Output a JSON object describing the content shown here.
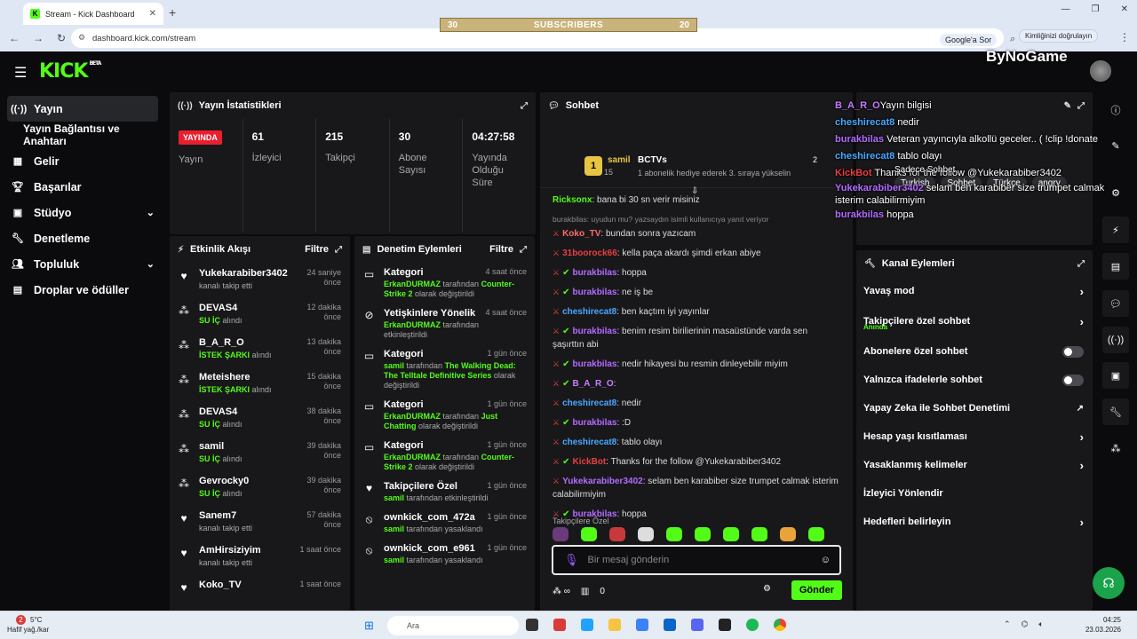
{
  "browser": {
    "tab_title": "Stream - Kick Dashboard",
    "url": "dashboard.kick.com/stream",
    "google_pill": "Google'a Sor",
    "verify_pill": "Kimliğinizi doğrulayın"
  },
  "sub_banner": {
    "left": "30",
    "title": "SUBSCRIBERS",
    "right": "20"
  },
  "header": {
    "logo": "KICK",
    "logo_beta": "BETA",
    "bynogame": "ByNoGame"
  },
  "sidebar": {
    "items": [
      {
        "label": "Yayın",
        "icon": "broadcast-icon"
      },
      {
        "label": "Yayın Bağlantısı ve Anahtarı"
      },
      {
        "label": "Gelir",
        "icon": "chart-icon"
      },
      {
        "label": "Başarılar",
        "icon": "trophy-icon"
      },
      {
        "label": "Stüdyo",
        "icon": "studio-icon"
      },
      {
        "label": "Denetleme",
        "icon": "wrench-icon"
      },
      {
        "label": "Topluluk",
        "icon": "people-icon"
      },
      {
        "label": "Droplar ve ödüller",
        "icon": "gift-icon"
      }
    ]
  },
  "stats": {
    "title": "Yayın İstatistikleri",
    "live": "YAYINDA",
    "live_label": "Yayın",
    "viewers": "61",
    "viewers_label": "İzleyici",
    "followers": "215",
    "followers_label": "Takipçi",
    "subs": "30",
    "subs_label": "Abone Sayısı",
    "duration": "04:27:58",
    "duration_label": "Yayında Olduğu Süre"
  },
  "activity": {
    "title": "Etkinlik Akışı",
    "filter": "Filtre",
    "items": [
      {
        "name": "Yukekarabiber3402",
        "desc": "kanalı takip etti",
        "hl": "",
        "time": "24 saniye önce"
      },
      {
        "name": "DEVAS4",
        "hl": "SU İÇ",
        "desc": " alındı",
        "time": "12 dakika önce"
      },
      {
        "name": "B_A_R_O",
        "hl": "İSTEK ŞARKI",
        "desc": " alındı",
        "time": "13 dakika önce"
      },
      {
        "name": "Meteishere",
        "hl": "İSTEK ŞARKI",
        "desc": " alındı",
        "time": "15 dakika önce"
      },
      {
        "name": "DEVAS4",
        "hl": "SU İÇ",
        "desc": " alındı",
        "time": "38 dakika önce"
      },
      {
        "name": "samil",
        "hl": "SU İÇ",
        "desc": " alındı",
        "time": "39 dakika önce"
      },
      {
        "name": "Gevrocky0",
        "hl": "SU İÇ",
        "desc": " alındı",
        "time": "39 dakika önce"
      },
      {
        "name": "Sanem7",
        "hl": "",
        "desc": "kanalı takip etti",
        "time": "57 dakika önce"
      },
      {
        "name": "AmHirsiziyim",
        "hl": "",
        "desc": "kanalı takip etti",
        "time": "1 saat önce"
      },
      {
        "name": "Koko_TV",
        "hl": "",
        "desc": "",
        "time": "1 saat önce"
      }
    ]
  },
  "moderation": {
    "title": "Denetim Eylemleri",
    "filter": "Filtre",
    "items": [
      {
        "name": "Kategori",
        "time": "4 saat önce",
        "u": "ErkanDURMAZ",
        "mid": " tarafından ",
        "hl": "Counter-Strike 2",
        "end": " olarak değiştirildi"
      },
      {
        "name": "Yetişkinlere Yönelik",
        "time": "4 saat önce",
        "u": "ErkanDURMAZ",
        "mid": " tarafından etkinleştirildi",
        "hl": "",
        "end": ""
      },
      {
        "name": "Kategori",
        "time": "1 gün önce",
        "u": "samil",
        "mid": " tarafından ",
        "hl": "The Walking Dead: The Telltale Definitive Series",
        "end": " olarak değiştirildi"
      },
      {
        "name": "Kategori",
        "time": "1 gün önce",
        "u": "ErkanDURMAZ",
        "mid": " tarafından ",
        "hl": "Just Chatting",
        "end": " olarak değiştirildi"
      },
      {
        "name": "Kategori",
        "time": "1 gün önce",
        "u": "ErkanDURMAZ",
        "mid": " tarafından ",
        "hl": "Counter-Strike 2",
        "end": " olarak değiştirildi"
      },
      {
        "name": "Takipçilere Özel",
        "time": "1 gün önce",
        "u": "samil",
        "mid": " tarafından etkinleştirildi",
        "hl": "",
        "end": ""
      },
      {
        "name": "ownkick_com_472a",
        "time": "1 gün önce",
        "u": "samil",
        "mid": " tarafından yasaklandı",
        "hl": "",
        "end": ""
      },
      {
        "name": "ownkick_com_e961",
        "time": "1 gün önce",
        "u": "samil",
        "mid": " tarafından yasaklandı",
        "hl": "",
        "end": ""
      }
    ]
  },
  "chat": {
    "title": "Sohbet",
    "pinned": {
      "badge": "1",
      "user": "samil",
      "count": "15",
      "team": "BCTVs",
      "num": "2",
      "desc": "1 abonelik hediye ederek 3. sıraya yükselin"
    },
    "reply_note": "burakbilas: uyudun mu? yazsaydın isimli kullanıcıya yanıt veriyor",
    "messages": [
      {
        "user": "Ricksonx",
        "color": "#53fc18",
        "text": ": bana bi 30 sn verir misiniz"
      },
      {
        "user": "Koko_TV",
        "color": "#ff6b6b",
        "text": ": bundan sonra yazıcam"
      },
      {
        "user": "31boorock66",
        "color": "#e83f3f",
        "text": ": kella paça akardı şimdi erkan abiye"
      },
      {
        "user": "burakbilas",
        "color": "#b36bff",
        "text": ": hoppa"
      },
      {
        "user": "burakbilas",
        "color": "#b36bff",
        "text": ": ne iş be"
      },
      {
        "user": "cheshirecat8",
        "color": "#4aa8ff",
        "text": ": ben kaçtım iyi yayınlar"
      },
      {
        "user": "burakbilas",
        "color": "#b36bff",
        "text": ": benim resim birilierinin masaüstünde varda sen şaşırttın abi"
      },
      {
        "user": "burakbilas",
        "color": "#b36bff",
        "text": ": nedir hikayesi bu resmin dinleyebilir miyim"
      },
      {
        "user": "B_A_R_O",
        "color": "#c77dff",
        "text": ":"
      },
      {
        "user": "cheshirecat8",
        "color": "#4aa8ff",
        "text": ": nedir"
      },
      {
        "user": "burakbilas",
        "color": "#b36bff",
        "text": ": :D"
      },
      {
        "user": "cheshirecat8",
        "color": "#4aa8ff",
        "text": ": tablo olayı"
      },
      {
        "user": "KickBot",
        "color": "#e83f3f",
        "text": ": Thanks for the follow @Yukekarabiber3402"
      },
      {
        "user": "Yukekarabiber3402",
        "color": "#b36bff",
        "text": ": selam ben karabiber size trumpet calmak isterim calabilirmiyim"
      },
      {
        "user": "burakbilas",
        "color": "#b36bff",
        "text": ": hoppa"
      }
    ],
    "emote_label": "Takipçilere Özel",
    "input_placeholder": "Bir mesaj gönderin",
    "footer_count": "0",
    "send": "Gönder"
  },
  "overlay": {
    "lines": [
      {
        "u": "B_A_R_O",
        "t": "Yayın bilgisi",
        "color": "#c77dff"
      },
      {
        "u": "cheshirecat8",
        "t": " nedir",
        "color": "#4aa8ff"
      },
      {
        "u": "burakbilas",
        "t": " Veteran yayıncıyla alkollü geceler.. ( !clip !donate",
        "color": "#b36bff"
      },
      {
        "u": "cheshirecat8",
        "t": " tablo olayı",
        "color": "#4aa8ff"
      },
      {
        "u": "KickBot",
        "t": " Thanks for the follow @Yukekarabiber3402",
        "color": "#e83f3f"
      },
      {
        "u": "Yukekarabiber3402",
        "t": " selam ben karabiber size trumpet calmak isterim calabilirmiyim",
        "color": "#b36bff"
      },
      {
        "u": "burakbilas",
        "t": " hoppa",
        "color": "#b36bff"
      }
    ],
    "category": "Sadece Sohbet"
  },
  "tags": [
    "Turkish",
    "Sohbet",
    "Türkçe",
    "angry"
  ],
  "channel_actions": {
    "title": "Kanal Eylemleri",
    "items": [
      {
        "label": "Yavaş mod",
        "kind": "chevron"
      },
      {
        "label": "Takipçilere özel sohbet",
        "sub": "Anında",
        "kind": "chevron"
      },
      {
        "label": "Abonelere özel sohbet",
        "kind": "toggle"
      },
      {
        "label": "Yalnızca ifadelerle sohbet",
        "kind": "toggle"
      },
      {
        "label": "Yapay Zeka ile Sohbet Denetimi",
        "kind": "external"
      },
      {
        "label": "Hesap yaşı kısıtlaması",
        "kind": "chevron"
      },
      {
        "label": "Yasaklanmış kelimeler",
        "kind": "chevron"
      },
      {
        "label": "İzleyici Yönlendir",
        "kind": "none"
      },
      {
        "label": "Hedefleri belirleyin",
        "kind": "chevron"
      }
    ]
  },
  "taskbar": {
    "temp": "5°C",
    "weather": "Hafif yağ./kar",
    "badge": "2",
    "search": "Ara",
    "time": "04:25",
    "date": "23.03.2026"
  },
  "colors": {
    "accent": "#53fc18",
    "live": "#ea1f2e",
    "panel": "#18181b"
  }
}
